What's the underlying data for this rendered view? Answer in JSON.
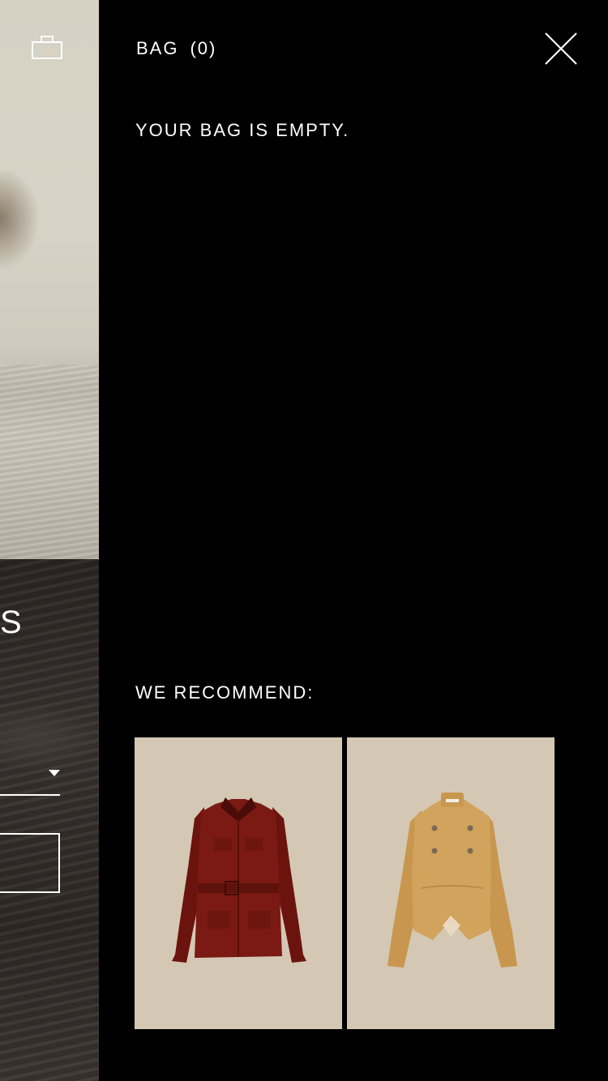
{
  "background_page": {
    "visible_letter": "S"
  },
  "drawer": {
    "title": "BAG",
    "count": "(0)",
    "empty_message": "YOUR BAG IS EMPTY.",
    "recommend_title": "WE RECOMMEND:",
    "recommendations": [
      {
        "icon": "burgundy-belted-jacket-image",
        "color": "#7a1a12"
      },
      {
        "icon": "camel-double-breasted-jacket-image",
        "color": "#d2a35c"
      }
    ]
  },
  "colors": {
    "drawer_bg": "#000000",
    "text": "#ffffff",
    "product_bg": "#d4c8b4"
  }
}
